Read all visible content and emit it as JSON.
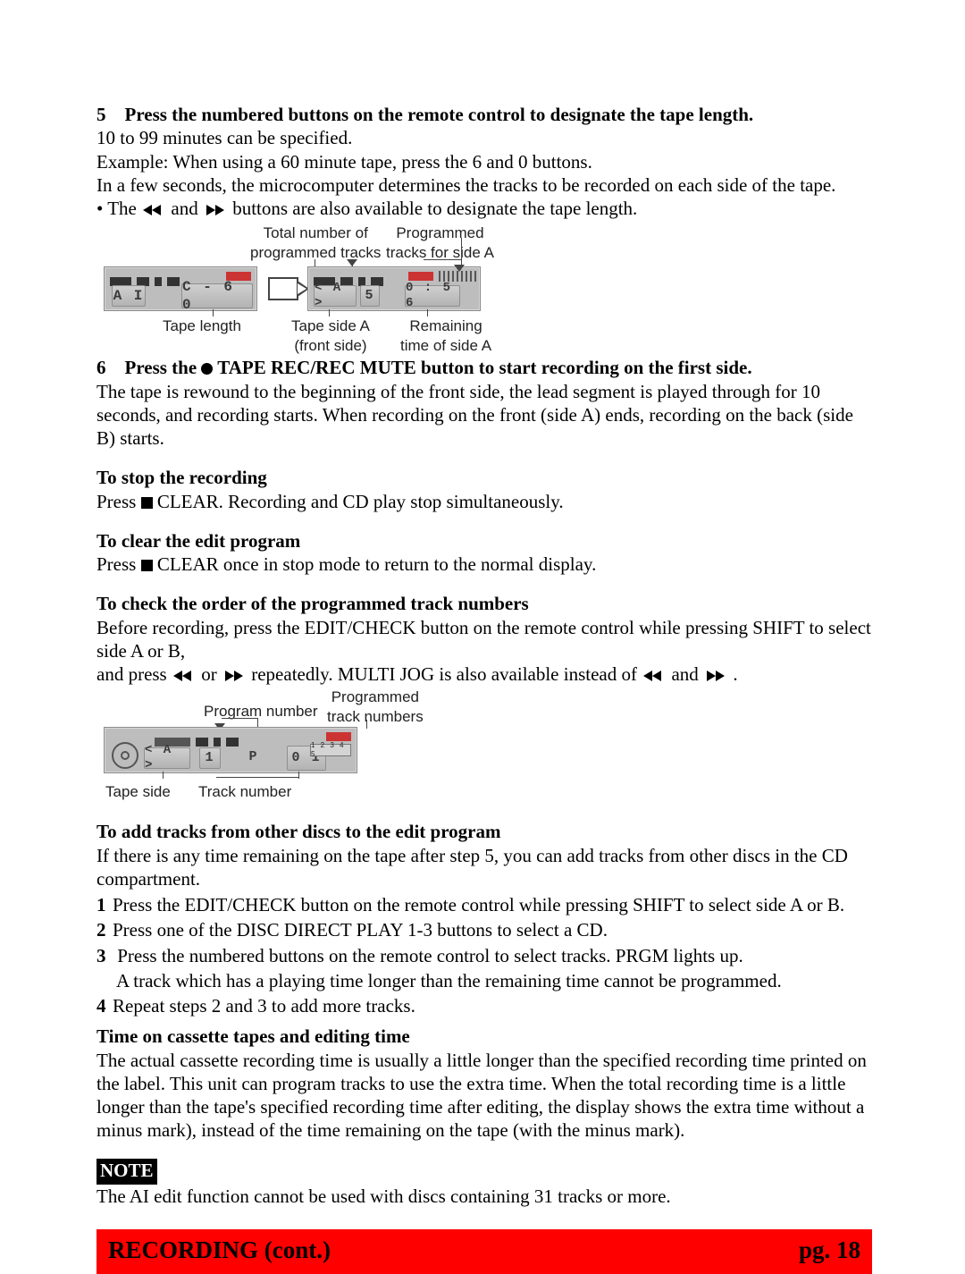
{
  "step5": {
    "num": "5",
    "heading": "Press the numbered buttons on the remote control to designate the tape length.",
    "line1": "10 to 99 minutes can be specified.",
    "line2": "Example: When using a 60 minute tape, press the 6 and 0 buttons.",
    "line3": "In a few seconds, the microcomputer determines the tracks to be recorded on each side of the tape.",
    "line4a": "• The ",
    "line4b": " and ",
    "line4c": " buttons are also available to designate the tape length."
  },
  "diagram1": {
    "top_label_left": "Total number of\nprogrammed tracks",
    "top_label_right": "Programmed\ntracks for side A",
    "lcd1_left": "A I",
    "lcd1_right": "C - 6 0",
    "lcd2_seg1": "< A >",
    "lcd2_seg2": "5",
    "lcd2_seg3": "0 : 5 6",
    "bottom_label_left": "Tape length",
    "bottom_label_mid": "Tape side A\n(front side)",
    "bottom_label_right": "Remaining\ntime of side A"
  },
  "step6": {
    "num": "6",
    "heading_a": "Press the ",
    "heading_b": " TAPE REC/REC MUTE button to start recording on the first side.",
    "body": "The tape is rewound to the beginning of the front side, the lead segment is played through for 10 seconds, and recording starts. When recording on the front (side A) ends, recording on the back (side B) starts."
  },
  "stopRec": {
    "heading": "To stop the recording",
    "body_a": "Press ",
    "body_b": " CLEAR.  Recording and CD play stop simultaneously."
  },
  "clearEdit": {
    "heading": "To clear the edit program",
    "body_a": "Press ",
    "body_b": " CLEAR once in stop mode to return to the normal display."
  },
  "checkOrder": {
    "heading": "To check the order of the programmed track numbers",
    "line1": "Before recording, press the EDIT/CHECK button on the remote control while pressing SHIFT to select side A or B,",
    "line2a": "and press ",
    "line2b": " or ",
    "line2c": " repeatedly. MULTI JOG is also available instead of ",
    "line2d": " and ",
    "line2e": " ."
  },
  "diagram2": {
    "top_label_left": "Program number",
    "top_label_right": "Programmed\ntrack numbers",
    "lcd_seg1": "< A >",
    "lcd_seg2": "1",
    "lcd_seg3": "P",
    "lcd_seg4": "0 1",
    "ticks": "1 2 3 4 5",
    "bottom_label_left": "Tape side",
    "bottom_label_right": "Track number"
  },
  "addTracks": {
    "heading": "To add tracks from other discs to the edit program",
    "intro": "If there is any time remaining on the tape after step 5, you can add tracks from other discs in the CD compartment.",
    "items": [
      {
        "n": "1",
        "t": "Press the EDIT/CHECK button on the remote control while pressing SHIFT to select side A or B."
      },
      {
        "n": "2",
        "t": "Press one of the DISC DIRECT PLAY 1-3 buttons to select a CD."
      },
      {
        "n": "3",
        "t": "Press the numbered buttons on the remote control to select tracks.  PRGM lights up."
      },
      {
        "n": "",
        "t": "A track which has a playing time longer than the remaining time cannot be programmed."
      },
      {
        "n": "4",
        "t": "Repeat steps 2 and 3 to add more tracks."
      }
    ]
  },
  "timeNote": {
    "heading": "Time on cassette tapes and editing time",
    "body": "The actual cassette recording time is usually a little longer than the specified recording time printed on the label. This unit can program tracks to use the extra time.  When the total recording time is a little longer than the tape's specified recording time after editing, the display shows the extra time without a minus mark), instead of the time remaining on the tape (with the minus mark)."
  },
  "note": {
    "label": "NOTE",
    "body": "The AI edit function cannot be used with discs containing 31 tracks or more."
  },
  "footer": {
    "title": "RECORDING (cont.)",
    "page": "pg. 18"
  }
}
